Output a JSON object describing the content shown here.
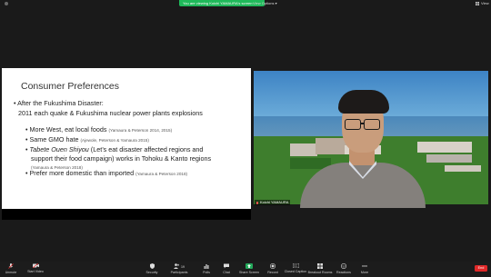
{
  "top_bar": {
    "banner_text": "You are viewing Koichi YAMAURA's screen",
    "view_options_label": "View Options ▾",
    "view_label": "View"
  },
  "slide": {
    "title": "Consumer Preferences",
    "bullets": [
      {
        "text": "• After the Fukushima Disaster:"
      },
      {
        "text": "2011 each quake & Fukushima nuclear power plants explosions"
      },
      {
        "text": "• More West, eat local foods",
        "ref": "(Yamaura & Peterson 2014, 2015)"
      },
      {
        "text": "• Same GMO hate",
        "ref": "(Ajewole, Peterson & Yamaura 2015)"
      },
      {
        "text_italic": "Tabete Ouen Shiyou",
        "text": " (Let’s eat disaster affected regions and"
      },
      {
        "text": "support their food campaign) works in Tohoku & Kanto regions"
      },
      {
        "ref": "(Yamaura & Peterson 2018)"
      },
      {
        "text": "• Prefer more domestic than imported",
        "ref": "(Yamaura & Peterson 2018)"
      }
    ],
    "bullet_char": "•"
  },
  "video": {
    "participant_name": "Koichi YAMAURA"
  },
  "toolbar": {
    "unmute": "Unmute",
    "start_video": "Start Video",
    "security": "Security",
    "participants": "Participants",
    "participants_count": "19",
    "polls": "Polls",
    "chat": "Chat",
    "share_screen": "Share Screen",
    "record": "Record",
    "closed_caption": "Closed Caption",
    "breakout_rooms": "Breakout Rooms",
    "reactions": "Reactions",
    "more": "More",
    "end": "End"
  },
  "colors": {
    "banner": "#1fb95a",
    "end_button": "#e02828",
    "background": "#1a1a1a"
  }
}
